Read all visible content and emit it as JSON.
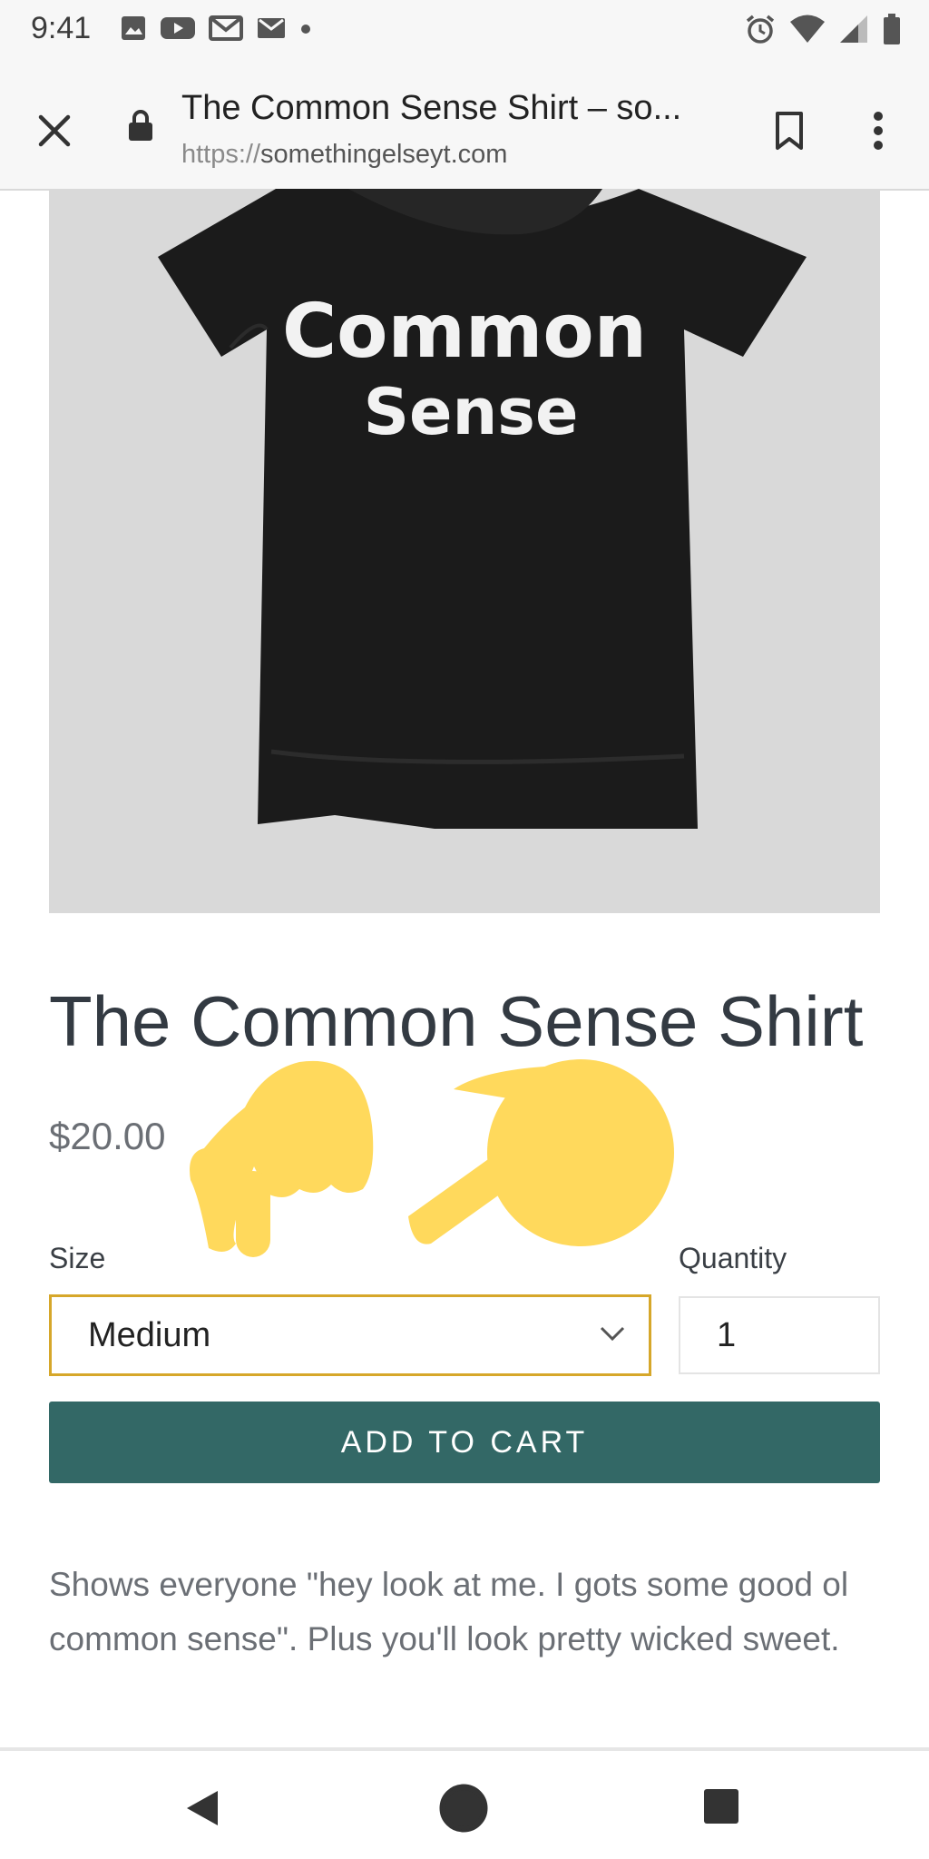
{
  "status_bar": {
    "time": "9:41",
    "left_icons": [
      "image-icon",
      "youtube-icon",
      "gmail-icon",
      "gmail-icon",
      "dot-icon"
    ],
    "right_icons": [
      "alarm-icon",
      "wifi-icon",
      "signal-icon",
      "battery-icon"
    ]
  },
  "browser": {
    "tab_title": "The Common Sense Shirt – so...",
    "url_scheme": "https://",
    "url_host": "somethingelseyt.com"
  },
  "product": {
    "image_alt": "Black t-shirt printed with Common Sense",
    "shirt_print_line1": "Common",
    "shirt_print_line2": "Sense",
    "title": "The Common Sense Shirt",
    "price": "$20.00",
    "size_label": "Size",
    "size_value": "Medium",
    "quantity_label": "Quantity",
    "quantity_value": "1",
    "add_to_cart_label": "ADD TO CART",
    "description": "Shows everyone \"hey look at me. I gots some good ol common sense\". Plus you'll look pretty wicked sweet."
  },
  "colors": {
    "accent_button": "#336866",
    "select_border": "#d6a72a",
    "emoji_hand": "#FFD95C"
  }
}
